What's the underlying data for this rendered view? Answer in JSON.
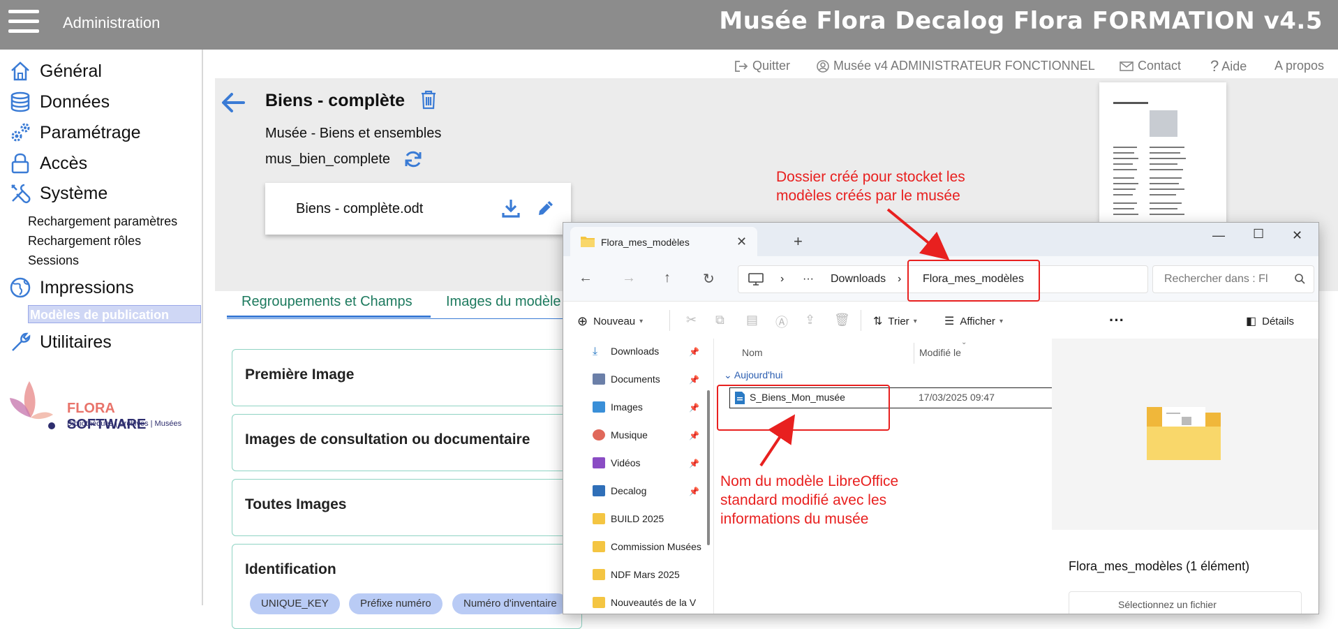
{
  "topbar": {
    "admin_label": "Administration",
    "app_title": "Musée Flora Decalog Flora FORMATION v4.5"
  },
  "sidebar": {
    "items": [
      {
        "label": "Général",
        "icon": "home-icon"
      },
      {
        "label": "Données",
        "icon": "database-icon"
      },
      {
        "label": "Paramétrage",
        "icon": "gears-icon"
      },
      {
        "label": "Accès",
        "icon": "lock-icon"
      },
      {
        "label": "Système",
        "icon": "tools-icon"
      },
      {
        "label": "Impressions",
        "icon": "globe-icon"
      },
      {
        "label": "Utilitaires",
        "icon": "wrench-icon"
      }
    ],
    "system_sub": [
      "Rechargement paramètres",
      "Rechargement rôles",
      "Sessions"
    ],
    "impressions_sub_active": "Modèles de publication",
    "logo": {
      "brand": "FLORA SOFTWARE",
      "brand_a": "FLORA",
      "brand_b": "SOFTWARE",
      "tagline": "Bibliothèques | Archives | Musées"
    }
  },
  "header_links": {
    "quit": "Quitter",
    "user": "Musée v4 ADMINISTRATEUR FONCTIONNEL",
    "contact": "Contact",
    "help": "Aide",
    "about": "A propos"
  },
  "record": {
    "title": "Biens - complète",
    "subtitle": "Musée - Biens et ensembles",
    "code": "mus_bien_complete",
    "file_name": "Biens - complète.odt"
  },
  "tabs": [
    "Regroupements et Champs",
    "Images du modèle"
  ],
  "sections": [
    "Première Image",
    "Images de consultation ou documentaire",
    "Toutes Images",
    "Identification"
  ],
  "chips": [
    "UNIQUE_KEY",
    "Préfixe numéro",
    "Numéro d'inventaire"
  ],
  "explorer": {
    "tab_title": "Flora_mes_modèles",
    "breadcrumb": [
      "Downloads",
      "Flora_mes_modèles"
    ],
    "search_placeholder": "Rechercher dans : Fl",
    "toolbar": {
      "new": "Nouveau",
      "sort": "Trier",
      "view": "Afficher",
      "details": "Détails"
    },
    "tree": [
      {
        "label": "Downloads",
        "pinned": true
      },
      {
        "label": "Documents",
        "pinned": true
      },
      {
        "label": "Images",
        "pinned": true
      },
      {
        "label": "Musique",
        "pinned": true
      },
      {
        "label": "Vidéos",
        "pinned": true
      },
      {
        "label": "Decalog",
        "pinned": true
      },
      {
        "label": "BUILD 2025",
        "pinned": false
      },
      {
        "label": "Commission Musées",
        "pinned": false
      },
      {
        "label": "NDF Mars 2025",
        "pinned": false
      },
      {
        "label": "Nouveautés de la V",
        "pinned": false
      }
    ],
    "columns": {
      "name": "Nom",
      "modified": "Modifié le"
    },
    "group": "Aujourd'hui",
    "file": {
      "name": "S_Biens_Mon_musée",
      "date": "17/03/2025 09:47"
    },
    "details_title": "Flora_mes_modèles (1 élément)",
    "details_hint": "Sélectionnez un fichier"
  },
  "annotations": {
    "folder_note": [
      "Dossier créé pour stocket les",
      "modèles créés par le musée"
    ],
    "model_note": [
      "Nom du modèle LibreOffice",
      "standard modifié avec les",
      "informations du musée"
    ]
  },
  "colors": {
    "accent": "#3a7bd5",
    "annotation": "#e8201f",
    "topbar": "#8c8c8c",
    "tab_text": "#1d7a5e"
  }
}
